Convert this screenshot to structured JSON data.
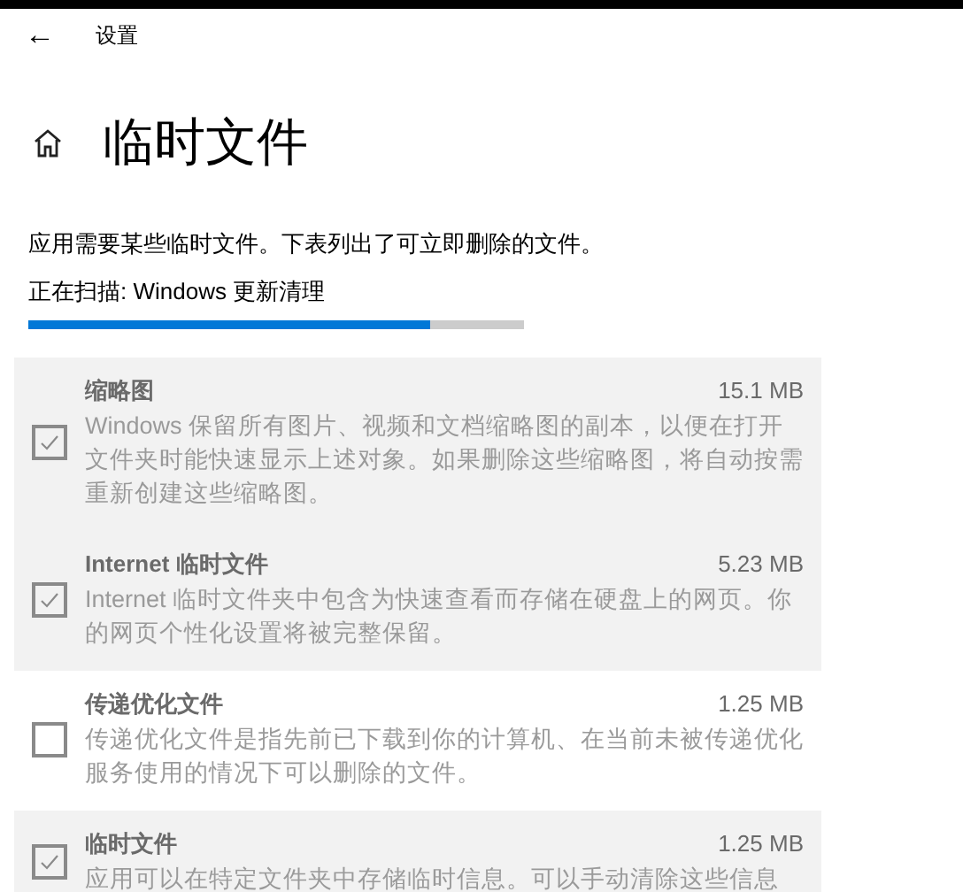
{
  "header": {
    "back": "←",
    "title": "设置"
  },
  "page": {
    "title": "临时文件",
    "description": "应用需要某些临时文件。下表列出了可立即删除的文件。",
    "scan_status": "正在扫描: Windows 更新清理",
    "scan_progress": {
      "level": 0.81
    }
  },
  "items": [
    {
      "name": "缩略图",
      "size": "15.1 MB",
      "description": "Windows 保留所有图片、视频和文档缩略图的副本，以便在打开文件夹时能快速显示上述对象。如果删除这些缩略图，将自动按需重新创建这些缩略图。",
      "checked": true,
      "disabled": true
    },
    {
      "name": "Internet 临时文件",
      "size": "5.23 MB",
      "description": "Internet 临时文件夹中包含为快速查看而存储在硬盘上的网页。你的网页个性化设置将被完整保留。",
      "checked": true,
      "disabled": true
    },
    {
      "name": "传递优化文件",
      "size": "1.25 MB",
      "description": "传递优化文件是指先前已下载到你的计算机、在当前未被传递优化服务使用的情况下可以删除的文件。",
      "checked": false,
      "disabled": true
    },
    {
      "name": "临时文件",
      "size": "1.25 MB",
      "description": "应用可以在特定文件夹中存储临时信息。可以手动清除这些信息",
      "checked": true,
      "disabled": true
    }
  ]
}
